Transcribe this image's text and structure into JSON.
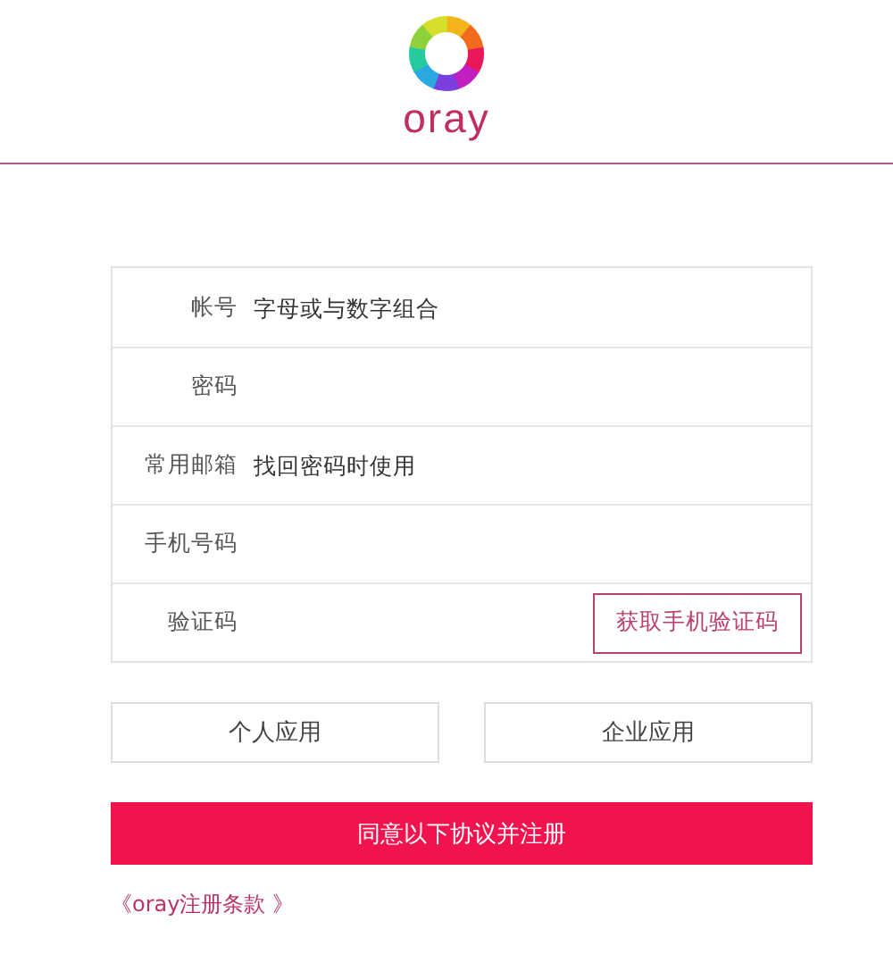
{
  "logo": {
    "text": "oray"
  },
  "form": {
    "fields": [
      {
        "label": "帐号",
        "placeholder": "字母或与数字组合",
        "kind": "text"
      },
      {
        "label": "密码",
        "kind": "text"
      },
      {
        "label": "常用邮箱",
        "placeholder": "找回密码时使用",
        "kind": "text"
      },
      {
        "label": "手机号码",
        "kind": "text"
      },
      {
        "label": "验证码",
        "kind": "code",
        "button": "获取手机验证码"
      }
    ]
  },
  "account_types": [
    {
      "label": "个人应用",
      "selected": false
    },
    {
      "label": "企业应用",
      "selected": false
    }
  ],
  "submit_button": "同意以下协议并注册",
  "terms_link": "《oray注册条款 》"
}
